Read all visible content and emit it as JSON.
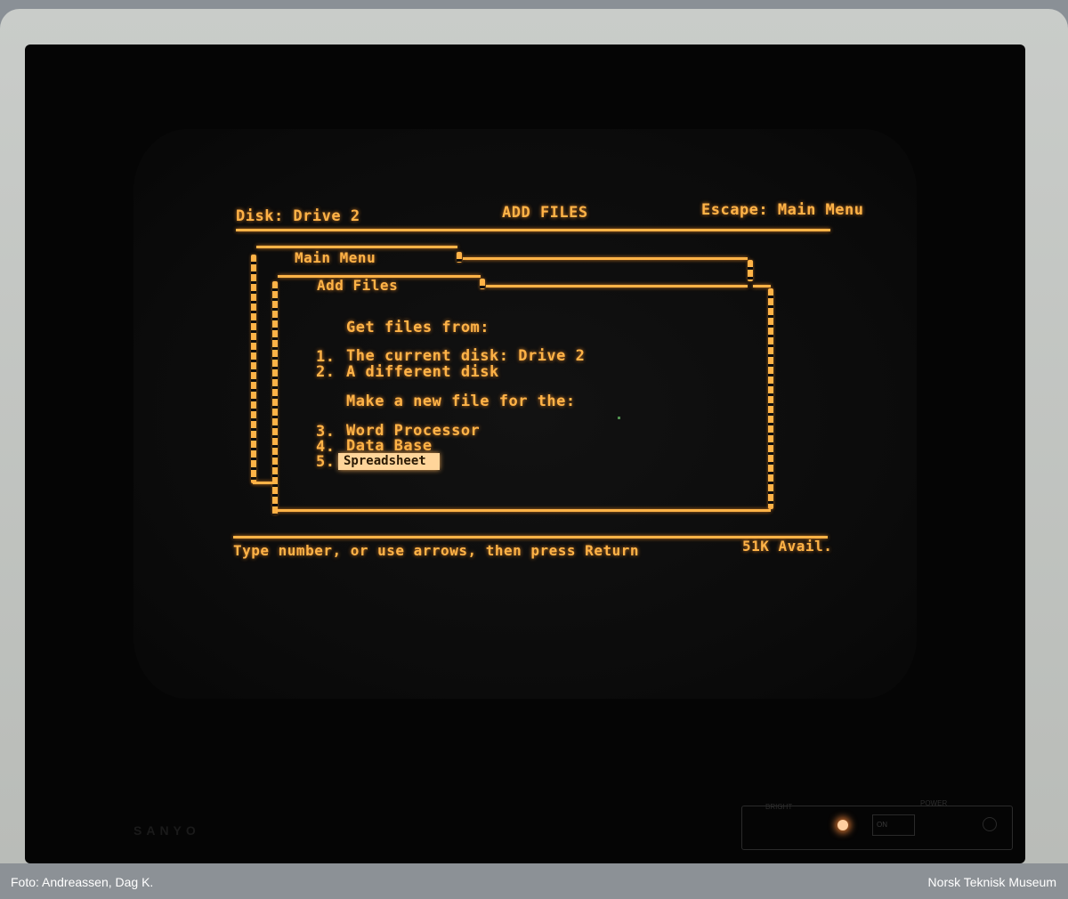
{
  "header": {
    "disk_label": "Disk: Drive 2",
    "title": "ADD FILES",
    "escape_hint": "Escape: Main Menu"
  },
  "windows": {
    "main_menu_title": "Main Menu",
    "add_files_title": "Add Files"
  },
  "menu": {
    "get_files_heading": "Get files from:",
    "make_new_heading": "Make a new file for the:",
    "items": [
      {
        "number": "1.",
        "label": "The current disk: Drive 2"
      },
      {
        "number": "2.",
        "label": "A different disk"
      },
      {
        "number": "3.",
        "label": "Word Processor"
      },
      {
        "number": "4.",
        "label": "Data Base"
      },
      {
        "number": "5.",
        "label": "Spreadsheet"
      }
    ],
    "selected_index": 5
  },
  "footer": {
    "instructions": "Type number, or use arrows, then press Return",
    "memory": "51K Avail."
  },
  "monitor": {
    "brand": "SANYO",
    "bright_label": "BRIGHT",
    "power_label": "POWER",
    "switch_label": "ON"
  },
  "caption": {
    "credit": "Foto: Andreassen, Dag K.",
    "museum": "Norsk Teknisk Museum"
  },
  "colors": {
    "phosphor": "#ffb347",
    "caption_bar": "#8c9196"
  }
}
